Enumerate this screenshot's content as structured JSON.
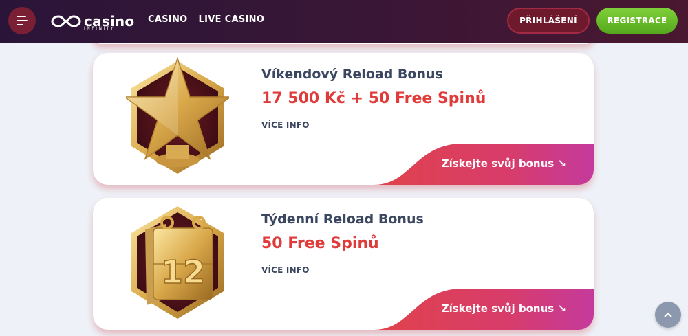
{
  "header": {
    "menu_icon": "hamburger-icon",
    "logo_text": "casino",
    "logo_subtext": "INFINITY",
    "nav": [
      "CASINO",
      "LIVE CASINO"
    ],
    "login_label": "PŘIHLÁŠENÍ",
    "register_label": "REGISTRACE"
  },
  "cards": [
    {
      "icon": "gold-star-icon",
      "title": "Víkendový Reload Bonus",
      "amount": "17 500 Kč + 50 Free Spinů",
      "more_label": "VÍCE INFO",
      "cta_label": "Získejte svůj bonus ↘"
    },
    {
      "icon": "calendar-12-icon",
      "title": "Týdenní Reload Bonus",
      "amount": "50 Free Spinů",
      "more_label": "VÍCE INFO",
      "cta_label": "Získejte svůj bonus ↘"
    }
  ],
  "scroll_top_icon": "chevron-up-icon",
  "colors": {
    "header_bg": "#3a1636",
    "accent_red": "#e03b3b",
    "register_green": "#66bb2a",
    "cta_start": "#e0434b",
    "cta_end": "#c43a9c"
  }
}
